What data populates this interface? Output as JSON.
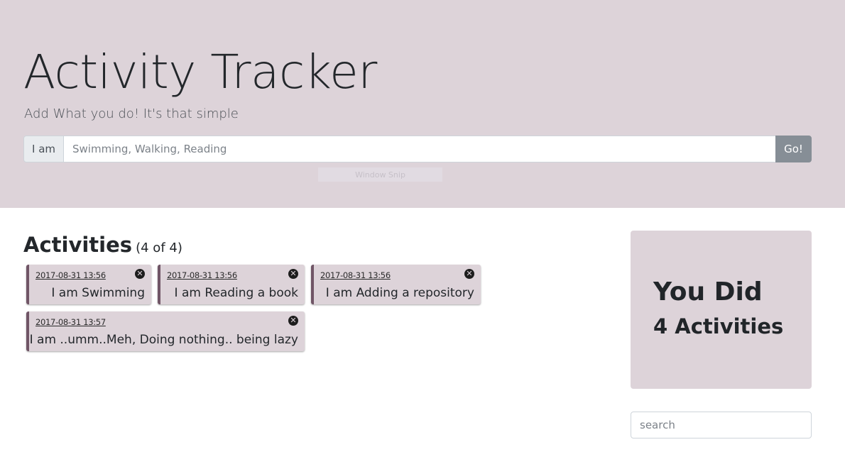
{
  "header": {
    "title": "Activity Tracker",
    "subtitle": "Add What you do! It's that simple",
    "input_prefix": "I am",
    "input_placeholder": "Swimming, Walking, Reading",
    "go_label": "Go!",
    "overlay_text": "Window Snip"
  },
  "activities": {
    "heading": "Activities",
    "count_label": "(4 of 4)",
    "items": [
      {
        "timestamp": "2017-08-31 13:56",
        "text": "I am Swimming"
      },
      {
        "timestamp": "2017-08-31 13:56",
        "text": "I am Reading a book"
      },
      {
        "timestamp": "2017-08-31 13:56",
        "text": "I am Adding a repository"
      },
      {
        "timestamp": "2017-08-31 13:57",
        "text": "I am ..umm..Meh, Doing nothing.. being lazy"
      }
    ],
    "close_icon": "close-circle-icon",
    "close_glyph": "✕"
  },
  "summary": {
    "line1": "You Did",
    "line2": "4 Activities"
  },
  "search": {
    "placeholder": "search"
  },
  "colors": {
    "accent_bg": "#ddd3d9",
    "card_border": "#705566",
    "go_button": "#868e96"
  }
}
